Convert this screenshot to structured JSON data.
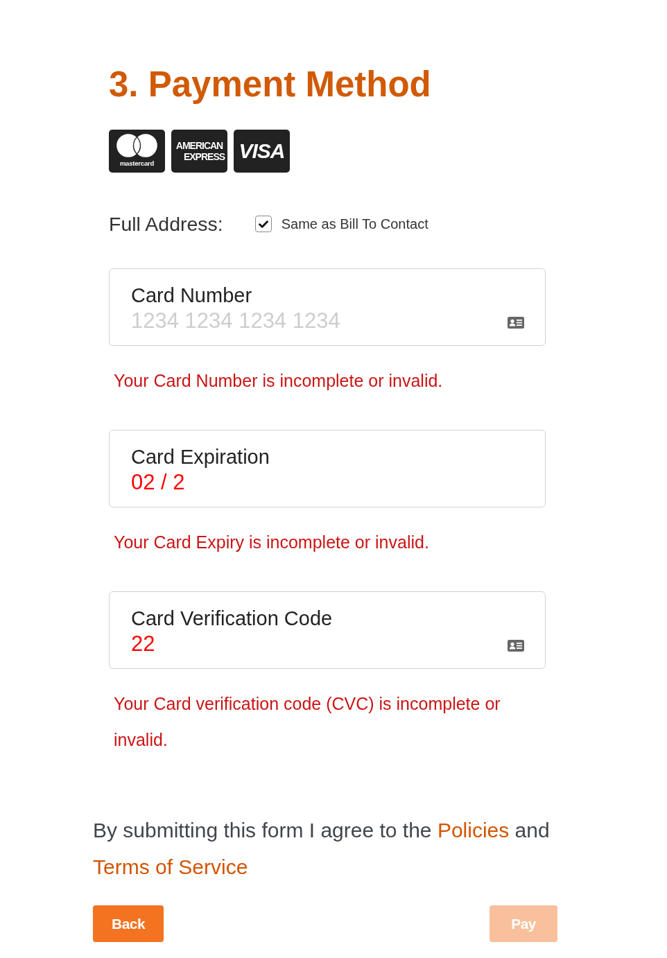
{
  "heading": "3. Payment Method",
  "card_brands": [
    {
      "kind": "mastercard",
      "lines": [
        "mastercard"
      ]
    },
    {
      "kind": "amex",
      "lines": [
        "AMERICAN",
        "EXPRESS"
      ]
    },
    {
      "kind": "visa",
      "lines": [
        "VISA"
      ]
    }
  ],
  "address": {
    "label": "Full Address:",
    "checkbox": {
      "label": "Same as Bill To Contact",
      "checked": true
    }
  },
  "fields": [
    {
      "label": "Card Number",
      "placeholder": "1234 1234 1234 1234",
      "icon": true,
      "error": "Your Card Number is incomplete or invalid."
    },
    {
      "label": "Card Expiration",
      "value": {
        "text": "02 / 2",
        "invalid": true
      },
      "icon": false,
      "error": "Your Card Expiry is incomplete or invalid."
    },
    {
      "label": "Card Verification Code",
      "value": {
        "text": "22",
        "invalid": true
      },
      "icon": true,
      "error": "Your Card verification code (CVC) is incomplete or invalid."
    }
  ],
  "agreement": {
    "parts": [
      {
        "kind": "text",
        "text": "By submitting this form I agree to the "
      },
      {
        "kind": "link",
        "text": "Policies"
      },
      {
        "kind": "text",
        "text": " and "
      },
      {
        "kind": "link",
        "text": "Terms of Service"
      }
    ]
  },
  "buttons": [
    {
      "label": "Back",
      "disabled": false
    },
    {
      "label": "Pay",
      "disabled": true
    }
  ]
}
